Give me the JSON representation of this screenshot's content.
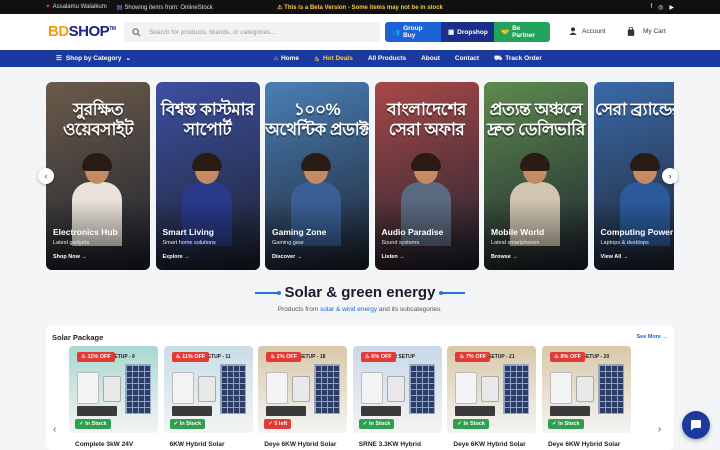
{
  "topbar": {
    "greeting": "Assalamu Walaikum",
    "showing": "Showing items from: OnlineStock",
    "notice": "This is a Beta Version - Some items may not be in stock",
    "social": [
      "f",
      "◎",
      "▶"
    ]
  },
  "header": {
    "logo_bd": "BD",
    "logo_shop": "SHOP",
    "logo_tm": "TM",
    "search_placeholder": "Search for products, brands, or categories...",
    "buttons": [
      "Group Buy",
      "Dropshop",
      "Be Partner"
    ],
    "account": "Account",
    "cart": "My Cart"
  },
  "nav": {
    "category": "Shop by Category",
    "links": [
      "Home",
      "Hot Deals",
      "All Products",
      "About",
      "Contact",
      "Track Order"
    ]
  },
  "banners": [
    {
      "bangla": "সুরক্ষিত ওয়েবসাইট",
      "title": "Electronics Hub",
      "sub": "Latest gadgets",
      "link": "Shop Now",
      "bg": "#6b5a4a",
      "body": "#e8e2d8"
    },
    {
      "bangla": "বিশ্বস্ত কাস্টমার সাপোর্ট",
      "title": "Smart Living",
      "sub": "Smart home solutions",
      "link": "Explore",
      "bg": "#3d4fa0",
      "body": "#2a3a8a"
    },
    {
      "bangla": "১০০% অথেন্টিক প্রডাক্ট",
      "title": "Gaming Zone",
      "sub": "Gaming gear",
      "link": "Discover",
      "bg": "#4a7fb5",
      "body": "#3a5f95"
    },
    {
      "bangla": "বাংলাদেশের সেরা অফার",
      "title": "Audio Paradise",
      "sub": "Sound systems",
      "link": "Listen",
      "bg": "#a84848",
      "body": "#5a6a80"
    },
    {
      "bangla": "প্রত্যন্ত অঞ্চলে দ্রুত ডেলিভারি",
      "title": "Mobile World",
      "sub": "Latest smartphones",
      "link": "Browse",
      "bg": "#5d8a4e",
      "body": "#cfc5b0"
    },
    {
      "bangla": "সেরা ব্র্যান্ডের প",
      "title": "Computing Power",
      "sub": "Laptops & desktops",
      "link": "View All",
      "bg": "#3a6aa8",
      "body": "#2a5a9a"
    }
  ],
  "section": {
    "title": "Solar & green energy",
    "sub_pre": "Products from ",
    "sub_link": "solar & wind energy",
    "sub_post": " and its subcategories."
  },
  "products_panel": {
    "title": "Solar Package",
    "see_more": "See More",
    "items": [
      {
        "tag": "SOLAR SETUP - 9",
        "discount": "11% OFF",
        "stock": "In Stock",
        "name": "Complete 3kW 24V",
        "bg": "#a8d8d0"
      },
      {
        "tag": "SOLAR SETUP - 11",
        "discount": "11% OFF",
        "stock": "In Stock",
        "name": "6KW Hybrid Solar",
        "bg": "#c8dde8"
      },
      {
        "tag": "SOLAR SETUP - 18",
        "discount": "2% OFF",
        "stock": "5 left",
        "name": "Deye 6KW Hybrid Solar",
        "bg": "#d8c8a8"
      },
      {
        "tag": "SOLAR SETUP",
        "discount": "6% OFF",
        "stock": "In Stock",
        "name": "SRNE 3.3KW Hybrid",
        "bg": "#c8d8e8"
      },
      {
        "tag": "SOLAR SETUP - 21",
        "discount": "7% OFF",
        "stock": "In Stock",
        "name": "Deye 6KW Hybrid Solar",
        "bg": "#d8c8a8"
      },
      {
        "tag": "SOLAR SETUP - 20",
        "discount": "8% OFF",
        "stock": "In Stock",
        "name": "Deye 6KW Hybrid Solar",
        "bg": "#d8c8a8"
      }
    ]
  },
  "colors": {
    "brand_blue": "#1a3aa0",
    "accent_orange": "#f39c12",
    "green": "#22a25a",
    "red": "#e53935"
  }
}
